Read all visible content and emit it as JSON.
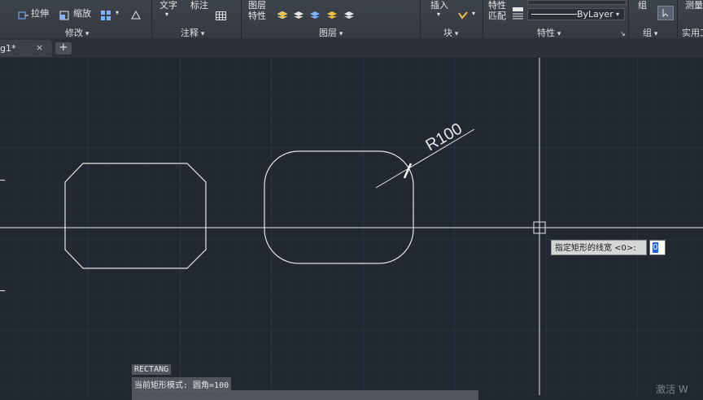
{
  "ribbon": {
    "modify": {
      "stretch": "拉伸",
      "scale": "缩放",
      "panel": "修改"
    },
    "annotate": {
      "text": "文字",
      "dimension": "标注",
      "panel": "注释"
    },
    "layers": {
      "layer_props_line1": "图层",
      "layer_props_line2": "特性",
      "panel": "图层"
    },
    "block": {
      "insert": "插入",
      "panel": "块"
    },
    "properties": {
      "match_line1": "特性",
      "match_line2": "匹配",
      "lineweight": "ByLayer",
      "panel": "特性"
    },
    "groups": {
      "group": "组",
      "panel": "组"
    },
    "utilities": {
      "measure": "测量",
      "panel": "实用工"
    }
  },
  "tab": {
    "label": "g1*",
    "close": "×",
    "new": "+"
  },
  "drawing": {
    "dimension_text": "R100"
  },
  "tooltip": {
    "prompt": "指定矩形的线宽 <0>:",
    "value": "0"
  },
  "command_history": {
    "line1": "RECTANG",
    "line2": "当前矩形模式:  圆角=100"
  },
  "watermark": "激活 W",
  "colors": {
    "background": "#212830",
    "geometry": "#e6e6e6",
    "grid": "#2f3845"
  }
}
